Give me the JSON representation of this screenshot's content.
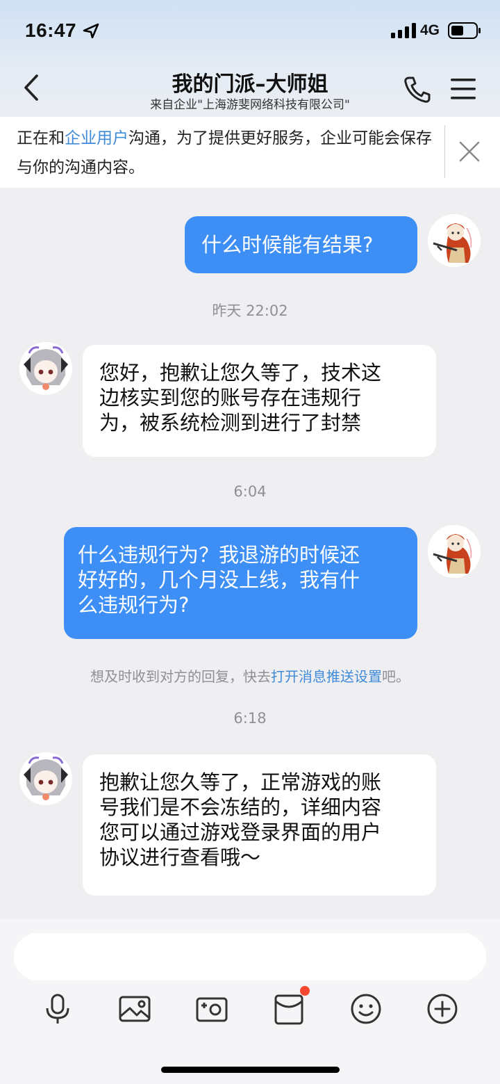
{
  "status": {
    "time": "16:47",
    "network": "4G"
  },
  "header": {
    "title": "我的门派–大师姐",
    "subtitle": "来自企业\"上海游斐网络科技有限公司\""
  },
  "notice": {
    "prefix": "正在和",
    "link": "企业用户",
    "suffix": "沟通，为了提供更好服务，企业可能会保存与你的沟通内容。"
  },
  "messages": [
    {
      "side": "out",
      "text": "什么时候能有结果?"
    },
    {
      "stamp": "昨天 22:02"
    },
    {
      "side": "in",
      "lines": [
        "您好，抱歉让您久等了，技术这",
        "边核实到您的账号存在违规行",
        "为，被系统检测到进行了封禁"
      ]
    },
    {
      "stamp": "6:04"
    },
    {
      "side": "out",
      "lines": [
        "什么违规行为？我退游的时候还",
        "好好的，几个月没上线，我有什",
        "么违规行为?"
      ]
    },
    {
      "hint_prefix": "想及时收到对方的回复，快去",
      "hint_link": "打开消息推送设置",
      "hint_suffix": "吧。"
    },
    {
      "stamp": "6:18"
    },
    {
      "side": "in",
      "lines": [
        "抱歉让您久等了，正常游戏的账",
        "号我们是不会冻结的，详细内容",
        "您可以通过游戏登录界面的用户",
        "协议进行查看哦～"
      ]
    }
  ],
  "toolbar": {
    "icons": [
      "microphone-icon",
      "image-icon",
      "camera-icon",
      "red-packet-icon",
      "emoji-icon",
      "plus-icon"
    ]
  },
  "colors": {
    "accent": "#3d8ff5",
    "link": "#3f8bd9",
    "badge": "#f4482f"
  }
}
